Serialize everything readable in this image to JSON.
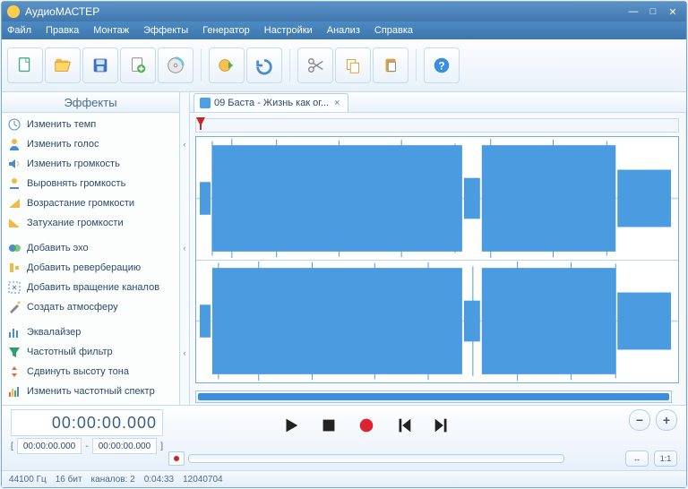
{
  "window": {
    "title": "АудиоМАСТЕР"
  },
  "menu": {
    "file": "Файл",
    "edit": "Правка",
    "montage": "Монтаж",
    "effects": "Эффекты",
    "generator": "Генератор",
    "settings": "Настройки",
    "analysis": "Анализ",
    "help": "Справка"
  },
  "toolbar_tips": {
    "new": "Новый",
    "open": "Открыть",
    "save": "Сохранить",
    "add": "Добавить",
    "cd": "Импорт с CD",
    "export": "Экспорт",
    "undo": "Отменить",
    "cut": "Вырезать",
    "copy": "Копировать",
    "paste": "Вставить",
    "help": "Справка"
  },
  "sidebar": {
    "header": "Эффекты",
    "groups": [
      [
        {
          "key": "tempo",
          "label": "Изменить темп",
          "icon": "clock"
        },
        {
          "key": "voice",
          "label": "Изменить голос",
          "icon": "person"
        },
        {
          "key": "volume",
          "label": "Изменить громкость",
          "icon": "speaker"
        },
        {
          "key": "normalize",
          "label": "Выровнять громкость",
          "icon": "level"
        },
        {
          "key": "fadein",
          "label": "Возрастание громкости",
          "icon": "fadein"
        },
        {
          "key": "fadeout",
          "label": "Затухание громкости",
          "icon": "fadeout"
        }
      ],
      [
        {
          "key": "echo",
          "label": "Добавить эхо",
          "icon": "echo"
        },
        {
          "key": "reverb",
          "label": "Добавить реверберацию",
          "icon": "reverb"
        },
        {
          "key": "rotate",
          "label": "Добавить вращение каналов",
          "icon": "rotate"
        },
        {
          "key": "atmos",
          "label": "Создать атмосферу",
          "icon": "magic"
        }
      ],
      [
        {
          "key": "eq",
          "label": "Эквалайзер",
          "icon": "bars"
        },
        {
          "key": "filter",
          "label": "Частотный фильтр",
          "icon": "funnel"
        },
        {
          "key": "pitch",
          "label": "Сдвинуть высоту тона",
          "icon": "pitch"
        },
        {
          "key": "spectrum",
          "label": "Изменить частотный спектр",
          "icon": "spectrum"
        }
      ]
    ]
  },
  "tab": {
    "label": "09 Баста - Жизнь как ог...",
    "close": "×"
  },
  "time": {
    "current": "00:00:00.000",
    "sel_start": "00:00:00.000",
    "sel_end": "00:00:00.000",
    "dash": "-",
    "bracket_open": "[",
    "bracket_close": "]"
  },
  "zoom": {
    "plus": "+",
    "minus": "−",
    "fit": "↔",
    "one": "1:1"
  },
  "status": {
    "rate": "44100 Гц",
    "bits": "16 бит",
    "channels": "каналов: 2",
    "duration": "0:04:33",
    "samples": "12040704"
  }
}
